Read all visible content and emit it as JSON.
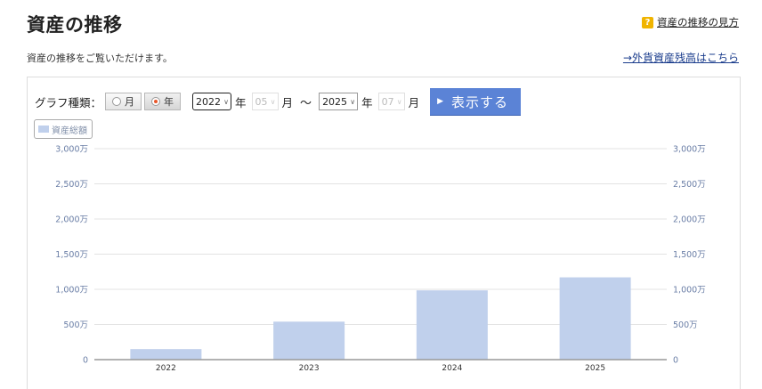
{
  "header": {
    "title": "資産の推移",
    "help_label": "資産の推移の見方",
    "description": "資産の推移をご覧いただけます。",
    "fx_link": "→外貨資産残高はこちら"
  },
  "controls": {
    "graph_type_label": "グラフ種類：",
    "radio_month": "月",
    "radio_year": "年",
    "selected_radio": "年",
    "from_year": "2022",
    "from_month": "05",
    "to_year": "2025",
    "to_month": "07",
    "year_unit": "年",
    "month_unit": "月",
    "tilde": "～",
    "show_button": "表示する"
  },
  "legend": {
    "label": "資産総額"
  },
  "colors": {
    "bar": "#c0d0ec",
    "button": "#5b83d6",
    "axis_text": "#6a7ea6"
  },
  "chart_data": {
    "type": "bar",
    "categories": [
      "2022",
      "2023",
      "2024",
      "2025"
    ],
    "series": [
      {
        "name": "資産総額",
        "values": [
          150,
          540,
          985,
          1170
        ]
      }
    ],
    "yticks": [
      "0",
      "500万",
      "1,000万",
      "1,500万",
      "2,000万",
      "2,500万",
      "3,000万"
    ],
    "ylim": [
      0,
      3000
    ],
    "unit": "万",
    "grid": true,
    "legend_position": "top-left"
  }
}
